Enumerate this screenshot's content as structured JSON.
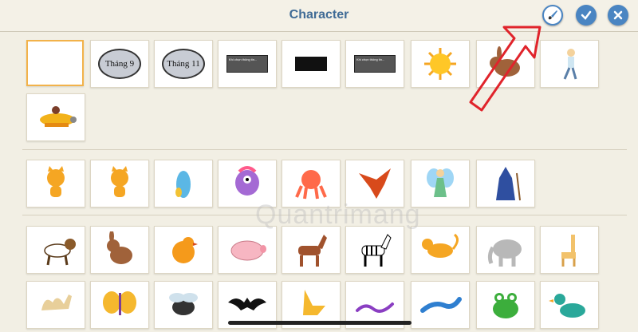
{
  "header": {
    "title": "Character",
    "paint_button": "paint-editor",
    "confirm_button": "check",
    "close_button": "close"
  },
  "row1": {
    "labels": {
      "thang9": "Tháng 9",
      "thang11": "Tháng 11",
      "screen_text": "Khi chọn thông tin..."
    }
  },
  "watermark": "Quantrimang",
  "colors": {
    "accent": "#4a85c2",
    "title": "#3f6b96",
    "selected_border": "#f2b24a",
    "arrow": "#e0242b"
  }
}
